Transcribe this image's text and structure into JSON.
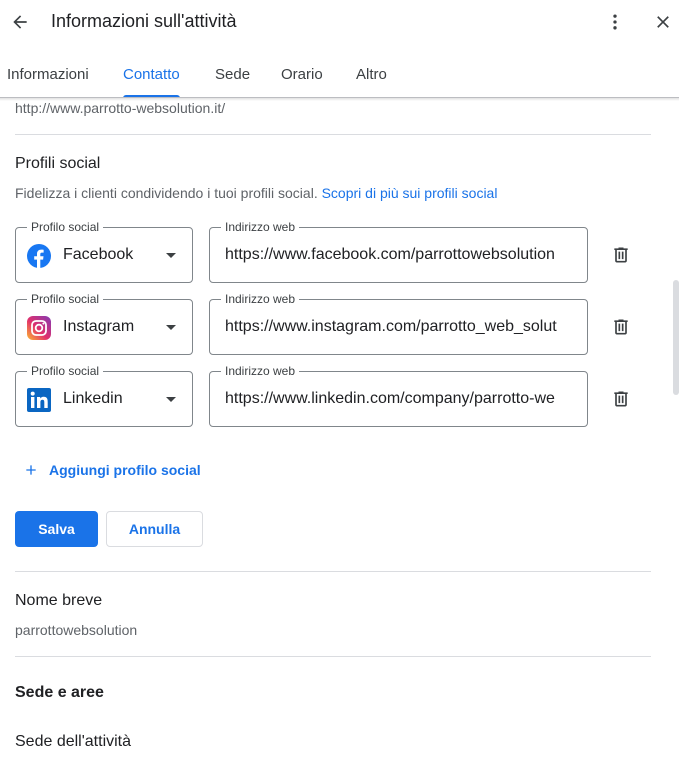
{
  "header": {
    "title": "Informazioni sull'attività",
    "back_icon": "arrow-back-icon",
    "more_icon": "more-vert-icon",
    "close_icon": "close-icon"
  },
  "tabs": [
    {
      "label": "Informazioni",
      "active": false
    },
    {
      "label": "Contatto",
      "active": true
    },
    {
      "label": "Sede",
      "active": false
    },
    {
      "label": "Orario",
      "active": false
    },
    {
      "label": "Altro",
      "active": false
    }
  ],
  "website": {
    "value": "http://www.parrotto-websolution.it/"
  },
  "social": {
    "title": "Profili social",
    "description": "Fidelizza i clienti condividendo i tuoi profili social.",
    "learn_more_link": "Scopri di più sui profili social",
    "select_label": "Profilo social",
    "url_label": "Indirizzo web",
    "profiles": [
      {
        "network": "Facebook",
        "icon": "facebook-icon",
        "url": "https://www.facebook.com/parrottowebsolution"
      },
      {
        "network": "Instagram",
        "icon": "instagram-icon",
        "url": "https://www.instagram.com/parrotto_web_solut"
      },
      {
        "network": "Linkedin",
        "icon": "linkedin-icon",
        "url": "https://www.linkedin.com/company/parrotto-we"
      }
    ],
    "add_label": "Aggiungi profilo social",
    "save_label": "Salva",
    "cancel_label": "Annulla"
  },
  "short_name": {
    "title": "Nome breve",
    "value": "parrottowebsolution"
  },
  "location": {
    "section_title": "Sede e aree",
    "subtitle": "Sede dell'attività"
  },
  "colors": {
    "accent": "#1a73e8",
    "facebook": "#1877f2",
    "linkedin": "#0a66c2",
    "text": "#202124",
    "muted": "#5f6368"
  }
}
